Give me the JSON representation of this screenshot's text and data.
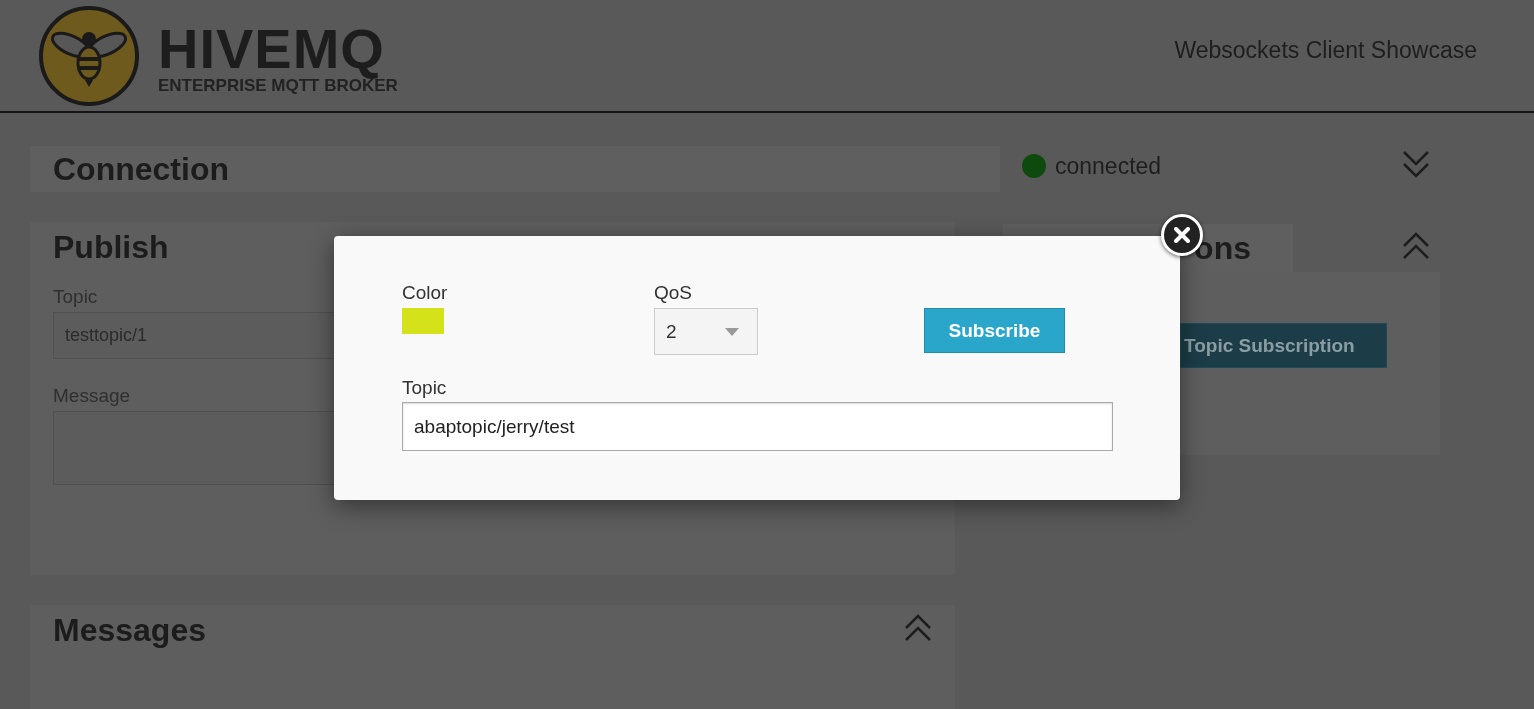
{
  "header": {
    "logo": {
      "title": "HIVEMQ",
      "subtitle": "ENTERPRISE MQTT BROKER"
    },
    "app_title": "Websockets Client Showcase"
  },
  "connection": {
    "title": "Connection",
    "status": "connected",
    "connected": true,
    "expanded": false
  },
  "publish": {
    "title": "Publish",
    "topic_label": "Topic",
    "topic": "testtopic/1",
    "message_label": "Message"
  },
  "subscriptions": {
    "title": "ons",
    "expanded": true,
    "add_button": "Topic Subscription"
  },
  "messages": {
    "title": "Messages",
    "expanded": true
  },
  "dialog": {
    "color_label": "Color",
    "color": "#d4e21a",
    "qos_label": "QoS",
    "qos": "2",
    "subscribe_button": "Subscribe",
    "topic_label": "Topic",
    "topic": "abaptopic/jerry/test"
  }
}
